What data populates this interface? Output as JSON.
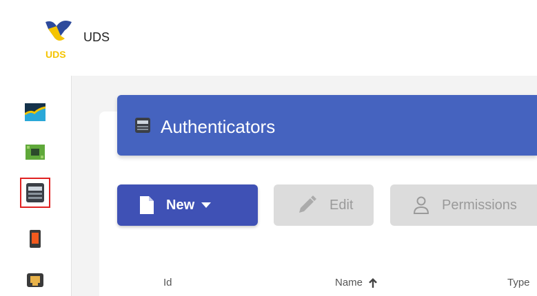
{
  "app": {
    "title": "UDS",
    "logo_text": "UDS"
  },
  "sidebar": {
    "items": [
      {
        "icon": "dashboard-chart-icon"
      },
      {
        "icon": "circuit-board-icon"
      },
      {
        "icon": "server-rack-icon",
        "selected": true
      },
      {
        "icon": "orange-device-icon"
      },
      {
        "icon": "network-port-icon"
      }
    ]
  },
  "page": {
    "title": "Authenticators",
    "header_color": "#4563bf"
  },
  "toolbar": {
    "new_label": "New",
    "edit_label": "Edit",
    "permissions_label": "Permissions"
  },
  "table": {
    "columns": [
      "Id",
      "Name",
      "Type"
    ],
    "sort_column": "Name",
    "sort_direction": "ascending"
  },
  "colors": {
    "accent": "#3f51b5",
    "selection_outline": "#e02020"
  }
}
